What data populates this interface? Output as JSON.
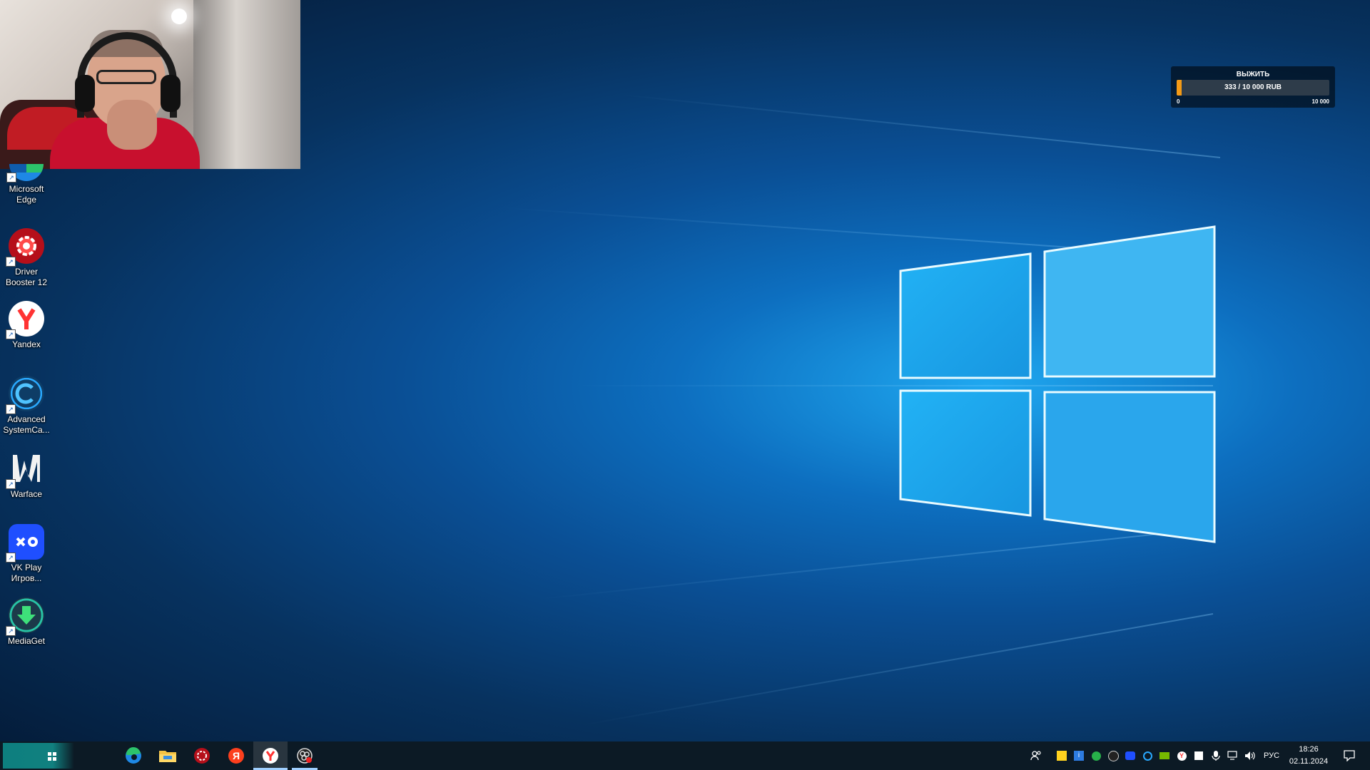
{
  "desktop_icons": [
    {
      "label": "Microsoft Edge",
      "icon": "edge-icon"
    },
    {
      "label": "Driver Booster 12",
      "icon": "driver-booster-icon"
    },
    {
      "label": "Yandex",
      "icon": "yandex-browser-icon"
    },
    {
      "label": "Advanced SystemCa...",
      "icon": "advanced-systemcare-icon"
    },
    {
      "label": "Warface",
      "icon": "warface-icon"
    },
    {
      "label": "VK Play Игров...",
      "icon": "vk-play-icon"
    },
    {
      "label": "MediaGet",
      "icon": "mediaget-icon"
    }
  ],
  "donation_widget": {
    "title": "ВЫЖИТЬ",
    "progress_text": "333 / 10 000 RUB",
    "min_label": "0",
    "max_label": "10 000",
    "current": 333,
    "goal": 10000,
    "bar_color": "#f39a16"
  },
  "taskbar": {
    "pinned": [
      "edge-icon",
      "file-explorer-icon",
      "driver-booster-icon",
      "yandex-icon",
      "yandex-browser-icon",
      "obs-icon"
    ],
    "language": "РУС",
    "time": "18:26",
    "date": "02.11.2024"
  },
  "colors": {
    "taskbar_bg": "#0c1a25",
    "start_accent": "#0d7f7f",
    "desktop_glow": "#1fa8f0"
  }
}
